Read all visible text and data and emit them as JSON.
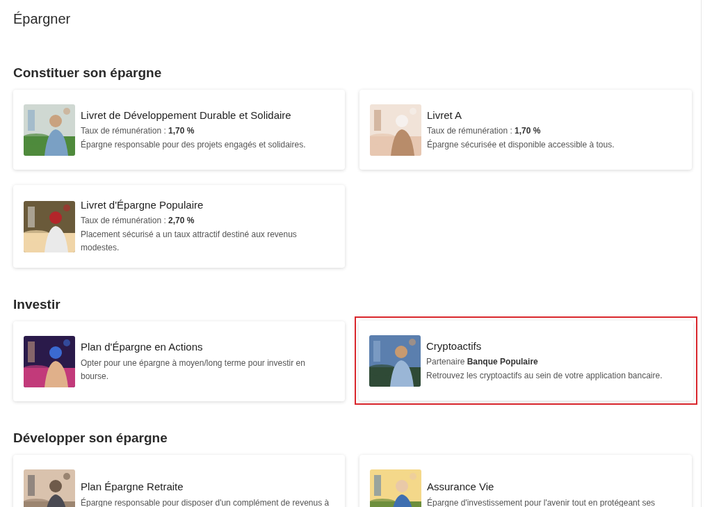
{
  "page_title": "Épargner",
  "sections": [
    {
      "heading": "Constituer son épargne",
      "cards": [
        {
          "title": "Livret de Développement Durable et Solidaire",
          "detail": "Taux de rémunération : **1,70 %**",
          "description": "Épargne responsable pour des projets engagés et solidaires.",
          "highlighted": false
        },
        {
          "title": "Livret A",
          "detail": "Taux de rémunération : **1,70 %**",
          "description": "Épargne sécurisée et disponible accessible à tous.",
          "highlighted": false
        },
        {
          "title": "Livret d'Épargne Populaire",
          "detail": "Taux de rémunération : **2,70 %**",
          "description": "Placement sécurisé a un taux attractif destiné aux revenus modestes.",
          "highlighted": false
        }
      ]
    },
    {
      "heading": "Investir",
      "cards": [
        {
          "title": "Plan d'Épargne en Actions",
          "description": "Opter pour une épargne à moyen/long terme pour investir en bourse.",
          "highlighted": false
        },
        {
          "title": "Cryptoactifs",
          "detail": "Partenaire **Banque Populaire**",
          "description": "Retrouvez les cryptoactifs au sein de votre application bancaire.",
          "highlighted": true
        }
      ]
    },
    {
      "heading": "Développer son épargne",
      "cards": [
        {
          "title": "Plan Épargne Retraite",
          "description": "Épargne responsable pour disposer d'un complément de revenus à",
          "highlighted": false
        },
        {
          "title": "Assurance Vie",
          "description": "Épargne d'investissement pour l'avenir tout en protégeant ses",
          "highlighted": false
        }
      ]
    }
  ]
}
